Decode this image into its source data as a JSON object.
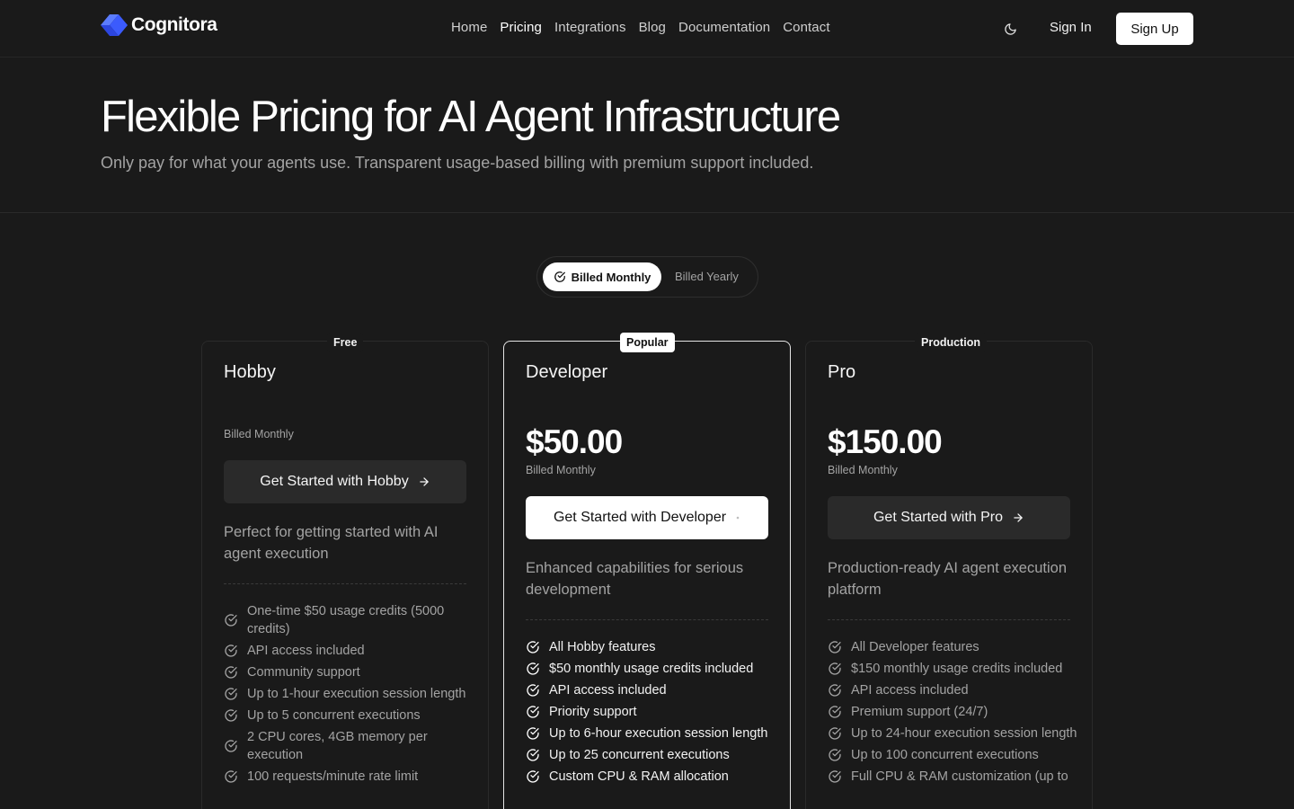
{
  "brand": {
    "name": "Cognitora",
    "accent": "#3b5bfd"
  },
  "nav": {
    "links": [
      "Home",
      "Pricing",
      "Integrations",
      "Blog",
      "Documentation",
      "Contact"
    ],
    "active": "Pricing",
    "theme_icon": "moon-icon",
    "sign_in": "Sign In",
    "sign_up": "Sign Up"
  },
  "hero": {
    "title": "Flexible Pricing for AI Agent Infrastructure",
    "subtitle": "Only pay for what your agents use. Transparent usage-based billing with premium support included."
  },
  "billing_toggle": {
    "options": [
      "Billed Monthly",
      "Billed Yearly"
    ],
    "selected": "Billed Monthly"
  },
  "plans": [
    {
      "badge": "Free",
      "name": "Hobby",
      "price": "",
      "billed": "Billed Monthly",
      "cta": "Get Started with Hobby",
      "description": "Perfect for getting started with AI agent execution",
      "features": [
        "One-time $50 usage credits (5000 credits)",
        "API access included",
        "Community support",
        "Up to 1-hour execution session length",
        "Up to 5 concurrent executions",
        "2 CPU cores, 4GB memory per execution",
        "100 requests/minute rate limit"
      ]
    },
    {
      "badge": "Popular",
      "name": "Developer",
      "price": "$50.00",
      "billed": "Billed Monthly",
      "cta": "Get Started with Developer",
      "description": "Enhanced capabilities for serious development",
      "features": [
        "All Hobby features",
        "$50 monthly usage credits included",
        "API access included",
        "Priority support",
        "Up to 6-hour execution session length",
        "Up to 25 concurrent executions",
        "Custom CPU & RAM allocation"
      ]
    },
    {
      "badge": "Production",
      "name": "Pro",
      "price": "$150.00",
      "billed": "Billed Monthly",
      "cta": "Get Started with Pro",
      "description": "Production-ready AI agent execution platform",
      "features": [
        "All Developer features",
        "$150 monthly usage credits included",
        "API access included",
        "Premium support (24/7)",
        "Up to 24-hour execution session length",
        "Up to 100 concurrent executions",
        "Full CPU & RAM customization (up to"
      ]
    }
  ]
}
